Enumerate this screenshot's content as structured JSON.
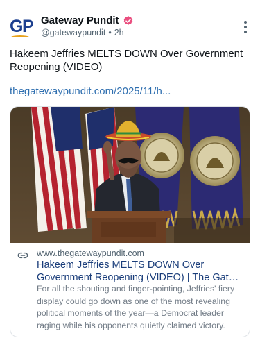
{
  "post": {
    "author_name": "Gateway Pundit",
    "handle": "@gatewaypundit",
    "separator": "•",
    "time": "2h",
    "avatar_text": "GP",
    "text": "Hakeem Jeffries MELTS DOWN Over Government Reopening (VIDEO)",
    "link_text": "thegatewaypundit.com/2025/11/h...",
    "icons": {
      "verified": "verified-badge-icon",
      "menu": "more-vertical-icon",
      "link": "link-icon"
    },
    "colors": {
      "verified": "#ea4f7f",
      "link": "#2f6fb0",
      "card_title": "#1a3d7a"
    }
  },
  "card": {
    "domain": "www.thegatewaypundit.com",
    "title_line1": "Hakeem Jeffries MELTS DOWN Over",
    "title_line2": "Government Reopening (VIDEO) | The Gateway Pundit",
    "description": "For all the shouting and finger-pointing, Jeffries' fiery display could go down as one of the most revealing political moments of the year—a Democrat leader raging while his opponents quietly claimed victory.",
    "image_alt": "Hakeem Jeffries at a podium with flags behind him"
  }
}
